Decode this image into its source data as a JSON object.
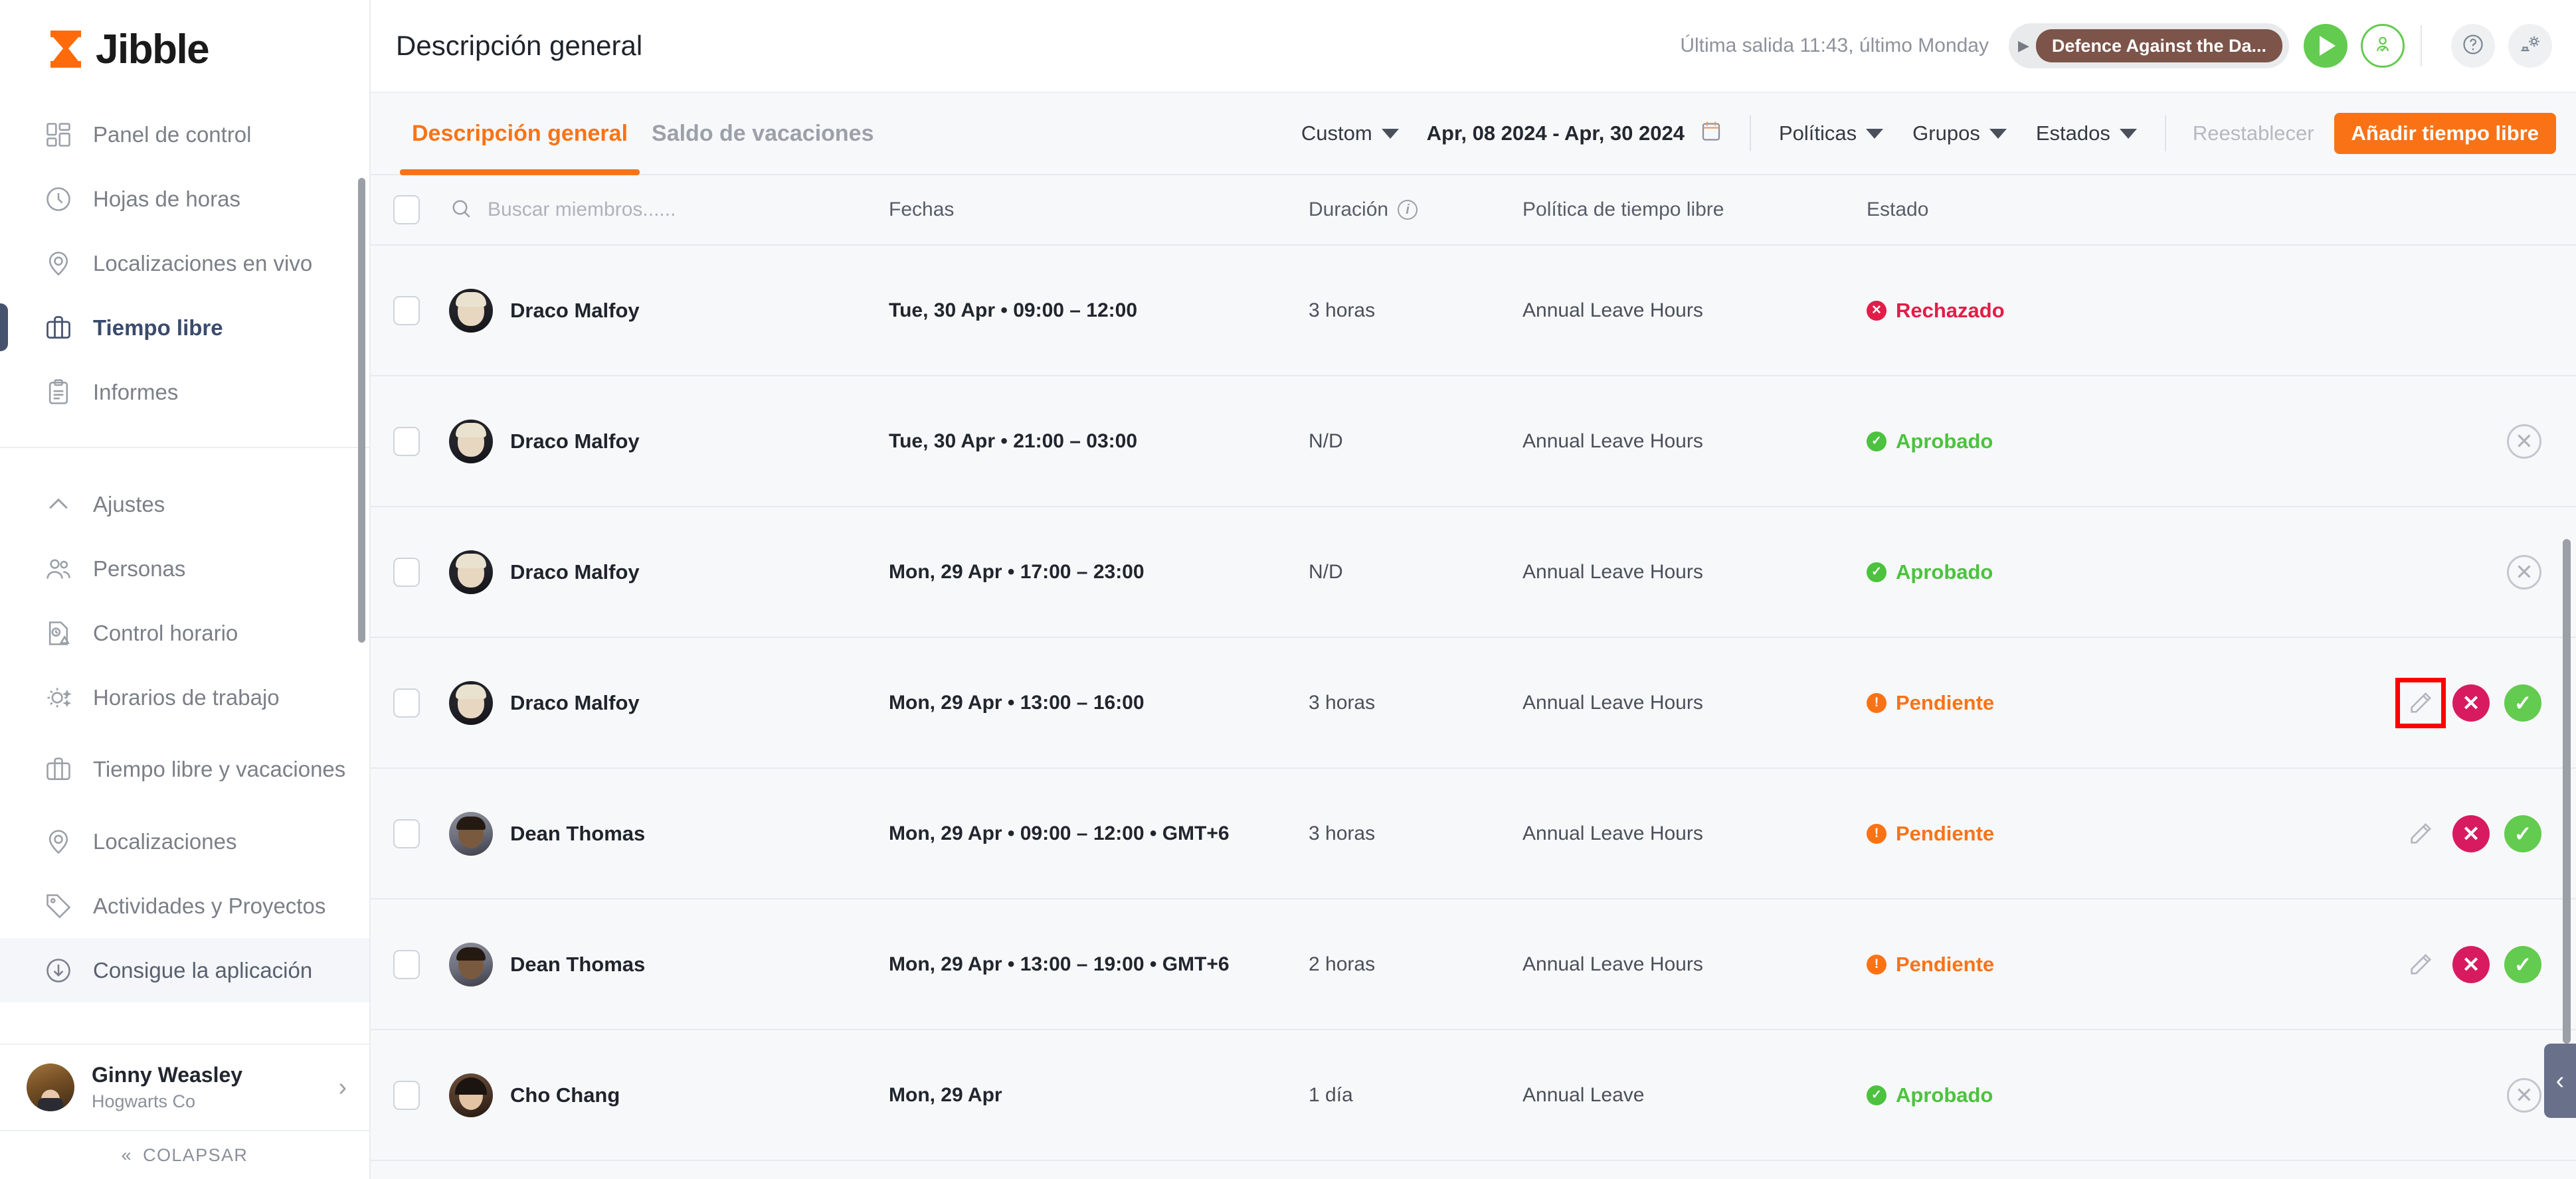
{
  "brand": {
    "name": "Jibble",
    "accent": "#f97316"
  },
  "sidebar": {
    "primary_items": [
      {
        "label": "Panel de control",
        "icon": "dashboard-icon"
      },
      {
        "label": "Hojas de horas",
        "icon": "clock-icon"
      },
      {
        "label": "Localizaciones en vivo",
        "icon": "map-pin-icon"
      },
      {
        "label": "Tiempo libre",
        "icon": "briefcase-icon",
        "active": true
      },
      {
        "label": "Informes",
        "icon": "clipboard-icon"
      }
    ],
    "settings_items": [
      {
        "label": "Ajustes",
        "icon": "chevron-up-icon"
      },
      {
        "label": "Personas",
        "icon": "people-icon"
      },
      {
        "label": "Control horario",
        "icon": "time-control-icon"
      },
      {
        "label": "Horarios de trabajo",
        "icon": "sun-moon-icon"
      },
      {
        "label": "Tiempo libre y vacaciones",
        "icon": "briefcase-icon"
      },
      {
        "label": "Localizaciones",
        "icon": "map-pin-icon"
      },
      {
        "label": "Actividades y Proyectos",
        "icon": "tag-icon"
      },
      {
        "label": "Consigue la aplicación",
        "icon": "download-icon",
        "highlight": true
      }
    ],
    "user": {
      "name": "Ginny Weasley",
      "org": "Hogwarts Co"
    },
    "collapse_label": "COLAPSAR"
  },
  "header": {
    "title": "Descripción general",
    "last_out": "Última salida 11:43, último Monday",
    "activity": "Defence Against the Da...",
    "play_label": "play-timer",
    "help_label": "help",
    "settings_label": "settings"
  },
  "tabs": [
    {
      "label": "Descripción general",
      "active": true
    },
    {
      "label": "Saldo de vacaciones",
      "active": false
    }
  ],
  "toolbar": {
    "range_preset": "Custom",
    "date_range": "Apr, 08 2024 - Apr, 30 2024",
    "filters": [
      "Políticas",
      "Grupos",
      "Estados"
    ],
    "reset_label": "Reestablecer",
    "add_label": "Añadir tiempo libre"
  },
  "table": {
    "search_placeholder": "Buscar miembros......",
    "search_value": "",
    "columns": [
      {
        "key": "dates",
        "label": "Fechas"
      },
      {
        "key": "duration",
        "label": "Duración",
        "info": true
      },
      {
        "key": "policy",
        "label": "Política de tiempo libre"
      },
      {
        "key": "status",
        "label": "Estado"
      }
    ],
    "rows": [
      {
        "name": "Draco Malfoy",
        "avatar": "av-draco",
        "dates": "Tue, 30 Apr • 09:00 – 12:00",
        "duration": "3 horas",
        "policy": "Annual Leave Hours",
        "status": "Rechazado",
        "status_kind": "rechazado",
        "actions": []
      },
      {
        "name": "Draco Malfoy",
        "avatar": "av-draco",
        "dates": "Tue, 30 Apr • 21:00 – 03:00",
        "duration": "N/D",
        "policy": "Annual Leave Hours",
        "status": "Aprobado",
        "status_kind": "aprobado",
        "actions": [
          "cancel"
        ]
      },
      {
        "name": "Draco Malfoy",
        "avatar": "av-draco",
        "dates": "Mon, 29 Apr • 17:00 – 23:00",
        "duration": "N/D",
        "policy": "Annual Leave Hours",
        "status": "Aprobado",
        "status_kind": "aprobado",
        "actions": [
          "cancel"
        ]
      },
      {
        "name": "Draco Malfoy",
        "avatar": "av-draco",
        "dates": "Mon, 29 Apr • 13:00 – 16:00",
        "duration": "3 horas",
        "policy": "Annual Leave Hours",
        "status": "Pendiente",
        "status_kind": "pendiente",
        "actions": [
          "edit-highlighted",
          "reject",
          "approve"
        ]
      },
      {
        "name": "Dean Thomas",
        "avatar": "av-dean",
        "dates": "Mon, 29 Apr • 09:00 – 12:00 • GMT+6",
        "duration": "3 horas",
        "policy": "Annual Leave Hours",
        "status": "Pendiente",
        "status_kind": "pendiente",
        "actions": [
          "edit",
          "reject",
          "approve"
        ]
      },
      {
        "name": "Dean Thomas",
        "avatar": "av-dean",
        "dates": "Mon, 29 Apr • 13:00 – 19:00 • GMT+6",
        "duration": "2 horas",
        "policy": "Annual Leave Hours",
        "status": "Pendiente",
        "status_kind": "pendiente",
        "actions": [
          "edit",
          "reject",
          "approve"
        ]
      },
      {
        "name": "Cho Chang",
        "avatar": "av-cho",
        "dates": "Mon, 29 Apr",
        "duration": "1 día",
        "policy": "Annual Leave",
        "status": "Aprobado",
        "status_kind": "aprobado",
        "actions": [
          "cancel"
        ]
      }
    ]
  },
  "side_panel_toggle": "collapse-panel"
}
